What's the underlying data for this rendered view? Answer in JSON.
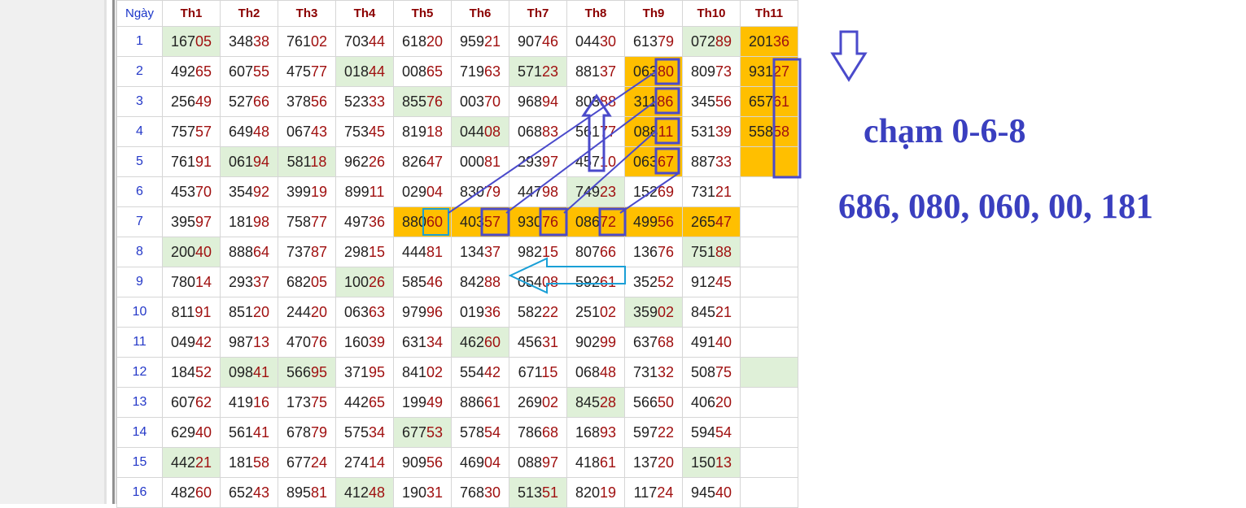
{
  "table": {
    "day_header": "Ngày",
    "columns": [
      "Th1",
      "Th2",
      "Th3",
      "Th4",
      "Th5",
      "Th6",
      "Th7",
      "Th8",
      "Th9",
      "Th10",
      "Th11"
    ],
    "rows": [
      {
        "day": "1",
        "cells": [
          "16705",
          "34838",
          "76102",
          "70344",
          "61820",
          "95921",
          "90746",
          "04430",
          "61379",
          "07289",
          "20136"
        ]
      },
      {
        "day": "2",
        "cells": [
          "49265",
          "60755",
          "47577",
          "01844",
          "00865",
          "71963",
          "57123",
          "88137",
          "06380",
          "80973",
          "93127"
        ]
      },
      {
        "day": "3",
        "cells": [
          "25649",
          "52766",
          "37856",
          "52333",
          "85576",
          "00370",
          "96894",
          "80388",
          "31186",
          "34556",
          "65761"
        ]
      },
      {
        "day": "4",
        "cells": [
          "75757",
          "64948",
          "06743",
          "75345",
          "81918",
          "04408",
          "06883",
          "56177",
          "08811",
          "53139",
          "55858"
        ]
      },
      {
        "day": "5",
        "cells": [
          "76191",
          "06194",
          "58118",
          "96226",
          "82647",
          "00081",
          "29397",
          "45710",
          "06367",
          "88733",
          ""
        ]
      },
      {
        "day": "6",
        "cells": [
          "45370",
          "35492",
          "39919",
          "89911",
          "02904",
          "83079",
          "44798",
          "74923",
          "15269",
          "73121",
          ""
        ]
      },
      {
        "day": "7",
        "cells": [
          "39597",
          "18198",
          "75877",
          "49736",
          "88060",
          "40357",
          "93076",
          "08672",
          "49956",
          "26547",
          ""
        ]
      },
      {
        "day": "8",
        "cells": [
          "20040",
          "88864",
          "73787",
          "29815",
          "44481",
          "13437",
          "98215",
          "80766",
          "13676",
          "75188",
          ""
        ]
      },
      {
        "day": "9",
        "cells": [
          "78014",
          "29337",
          "68205",
          "10026",
          "58546",
          "84288",
          "05408",
          "59261",
          "35252",
          "91245",
          ""
        ]
      },
      {
        "day": "10",
        "cells": [
          "81191",
          "85120",
          "24420",
          "06363",
          "97996",
          "01936",
          "58222",
          "25102",
          "35902",
          "84521",
          ""
        ]
      },
      {
        "day": "11",
        "cells": [
          "04942",
          "98713",
          "47076",
          "16039",
          "63134",
          "46260",
          "45631",
          "90299",
          "63768",
          "49140",
          ""
        ]
      },
      {
        "day": "12",
        "cells": [
          "18452",
          "09841",
          "56695",
          "37195",
          "84102",
          "55442",
          "67115",
          "06848",
          "73132",
          "50875",
          ""
        ]
      },
      {
        "day": "13",
        "cells": [
          "60762",
          "41916",
          "17375",
          "44265",
          "19949",
          "88661",
          "26902",
          "84528",
          "56650",
          "40620",
          ""
        ]
      },
      {
        "day": "14",
        "cells": [
          "62940",
          "56141",
          "67879",
          "57534",
          "67753",
          "57854",
          "78668",
          "16893",
          "59722",
          "59454",
          ""
        ]
      },
      {
        "day": "15",
        "cells": [
          "44221",
          "18158",
          "67724",
          "27414",
          "90956",
          "46904",
          "08897",
          "41861",
          "13720",
          "15013",
          ""
        ]
      },
      {
        "day": "16",
        "cells": [
          "48260",
          "65243",
          "89581",
          "41248",
          "19031",
          "76830",
          "51351",
          "82019",
          "11724",
          "94540",
          ""
        ]
      }
    ],
    "green_cells": [
      [
        0,
        0
      ],
      [
        0,
        9
      ],
      [
        1,
        3
      ],
      [
        1,
        6
      ],
      [
        2,
        4
      ],
      [
        3,
        5
      ],
      [
        4,
        1
      ],
      [
        4,
        2
      ],
      [
        5,
        7
      ],
      [
        7,
        0
      ],
      [
        7,
        9
      ],
      [
        8,
        3
      ],
      [
        9,
        8
      ],
      [
        10,
        5
      ],
      [
        11,
        1
      ],
      [
        11,
        2
      ],
      [
        11,
        10
      ],
      [
        12,
        7
      ],
      [
        13,
        4
      ],
      [
        14,
        0
      ],
      [
        14,
        9
      ],
      [
        15,
        3
      ],
      [
        15,
        6
      ]
    ],
    "orange_cells": [
      [
        0,
        10
      ],
      [
        1,
        8
      ],
      [
        1,
        10
      ],
      [
        2,
        8
      ],
      [
        2,
        10
      ],
      [
        3,
        8
      ],
      [
        3,
        10
      ],
      [
        4,
        8
      ],
      [
        4,
        10
      ],
      [
        6,
        4
      ],
      [
        6,
        5
      ],
      [
        6,
        6
      ],
      [
        6,
        7
      ],
      [
        6,
        8
      ],
      [
        6,
        9
      ]
    ],
    "colors": {
      "orange": "#ffbf00",
      "green": "#dff0d8",
      "annotation": "#3a3fbf",
      "box": "#4a4acb",
      "cyan": "#1a9fd6",
      "tail": "#a01010",
      "day": "#2438c8"
    }
  },
  "annotations": {
    "title": "chạm 0-6-8",
    "numbers": "686, 080, 060, 00, 181"
  }
}
